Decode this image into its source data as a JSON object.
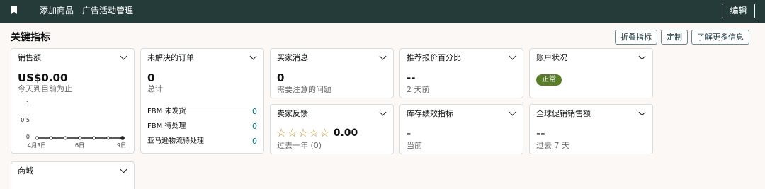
{
  "topbar": {
    "bookmark_icon": "bookmark-icon",
    "links": [
      "添加商品",
      "广告活动管理"
    ],
    "edit_label": "编辑"
  },
  "section": {
    "title": "关键指标",
    "buttons": [
      "折叠指标",
      "定制",
      "了解更多信息"
    ]
  },
  "cards": {
    "sales": {
      "title": "销售额",
      "value": "US$0.00",
      "sub": "今天到目前为止",
      "chart_data": {
        "type": "line",
        "x": [
          "4月3日",
          "4日",
          "5日",
          "6日",
          "7日",
          "8日",
          "9日"
        ],
        "y": [
          0,
          0,
          0,
          0,
          0,
          0,
          0
        ],
        "x_tick_labels": [
          "4月3日",
          "6日",
          "9日"
        ],
        "y_tick_labels": [
          "1",
          "0.5",
          "0"
        ],
        "ylim": [
          0,
          1
        ],
        "series_color": "#222222",
        "grid": false
      }
    },
    "orders": {
      "title": "未解决的订单",
      "value": "0",
      "sub": "总计",
      "rows": [
        {
          "label": "FBM 未发货",
          "value": "0"
        },
        {
          "label": "FBM 待处理",
          "value": "0"
        },
        {
          "label": "亚马逊物流待处理",
          "value": "0"
        }
      ]
    },
    "buyer_messages": {
      "title": "买家消息",
      "value": "0",
      "sub": "需要注意的问题"
    },
    "featured_offer": {
      "title": "推荐报价百分比",
      "value": "--",
      "sub": "2 天前"
    },
    "account_health": {
      "title": "账户状况",
      "badge": "正常",
      "badge_color": "#5a7d2a"
    },
    "seller_feedback": {
      "title": "卖家反馈",
      "stars_filled": 0,
      "stars_total": 5,
      "value": "0.00",
      "sub": "过去一年 (0)"
    },
    "inventory": {
      "title": "库存绩效指标",
      "value": "-",
      "sub": "当前"
    },
    "global_promo": {
      "title": "全球促销销售额",
      "value": "--",
      "sub": "过去 7 天"
    },
    "store": {
      "title": "商城"
    }
  }
}
